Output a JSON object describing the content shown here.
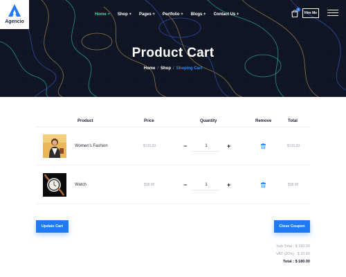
{
  "brand": {
    "name": "Agencio"
  },
  "nav": {
    "items": [
      {
        "label": "Home +",
        "active": true
      },
      {
        "label": "Shop +",
        "active": false
      },
      {
        "label": "Pages +",
        "active": false
      },
      {
        "label": "Portfolio +",
        "active": false
      },
      {
        "label": "Blogs +",
        "active": false
      },
      {
        "label": "Contact Us +",
        "active": false
      }
    ],
    "cart_count": "0",
    "hire_label": "Hire Me"
  },
  "hero": {
    "title": "Product Cart",
    "breadcrumb": [
      "Home",
      "Shop",
      "Shoping Cart"
    ]
  },
  "table": {
    "headers": {
      "product": "Product",
      "price": "Price",
      "quantity": "Quantity",
      "remove": "Remove",
      "total": "Total"
    },
    "rows": [
      {
        "name": "Women's Fashion",
        "price": "$133.00",
        "qty": "1",
        "total": "$133.00"
      },
      {
        "name": "Watch",
        "price": "$38.00",
        "qty": "1",
        "total": "$38.00"
      }
    ]
  },
  "actions": {
    "update": "Update Cart",
    "coupon": "Close Coupon"
  },
  "summary": {
    "subtotal": "Sub Total : $ 160.00",
    "vat": "VAT (20%) : $ 20.00",
    "total": "Total : $ 180.00"
  },
  "colors": {
    "accent": "#1e7af5",
    "nav_active": "#3fe1b0",
    "hero_bg": "#0f1523"
  }
}
